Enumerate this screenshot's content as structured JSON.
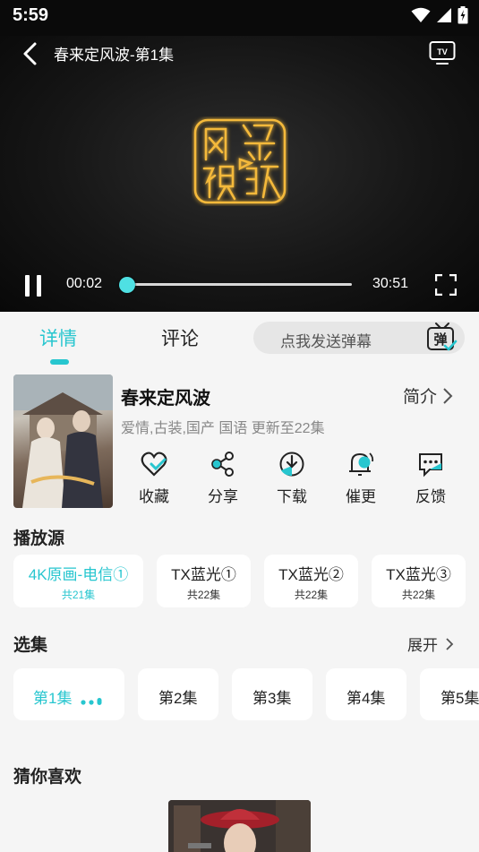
{
  "status": {
    "time": "5:59"
  },
  "player": {
    "title": "春来定风波-第1集",
    "current_time": "00:02",
    "total_time": "30:51",
    "progress": 0.001,
    "tv_label": "TV",
    "logo_text": "网络视频"
  },
  "tabs": [
    {
      "label": "详情",
      "active": true
    },
    {
      "label": "评论",
      "active": false
    }
  ],
  "danmu": {
    "placeholder": "点我发送弹幕",
    "icon_text": "弹"
  },
  "show": {
    "title": "春来定风波",
    "intro_label": "简介",
    "meta": "爱情,古装,国产 国语 更新至22集"
  },
  "actions": [
    {
      "label": "收藏",
      "icon": "heart-icon"
    },
    {
      "label": "分享",
      "icon": "share-icon"
    },
    {
      "label": "下载",
      "icon": "download-icon"
    },
    {
      "label": "催更",
      "icon": "bell-icon"
    },
    {
      "label": "反馈",
      "icon": "feedback-icon"
    }
  ],
  "sources": {
    "title": "播放源",
    "items": [
      {
        "name": "4K原画-电信①",
        "count": "共21集",
        "active": true
      },
      {
        "name": "TX蓝光①",
        "count": "共22集",
        "active": false
      },
      {
        "name": "TX蓝光②",
        "count": "共22集",
        "active": false
      },
      {
        "name": "TX蓝光③",
        "count": "共22集",
        "active": false
      }
    ]
  },
  "episodes": {
    "title": "选集",
    "expand_label": "展开",
    "items": [
      {
        "label": "第1集",
        "active": true
      },
      {
        "label": "第2集",
        "active": false
      },
      {
        "label": "第3集",
        "active": false
      },
      {
        "label": "第4集",
        "active": false
      },
      {
        "label": "第5集",
        "active": false
      }
    ]
  },
  "recommend": {
    "title": "猜你喜欢"
  },
  "colors": {
    "accent": "#27c6cf",
    "background": "#f5f5f5",
    "player_bg": "#0a0a0a"
  }
}
